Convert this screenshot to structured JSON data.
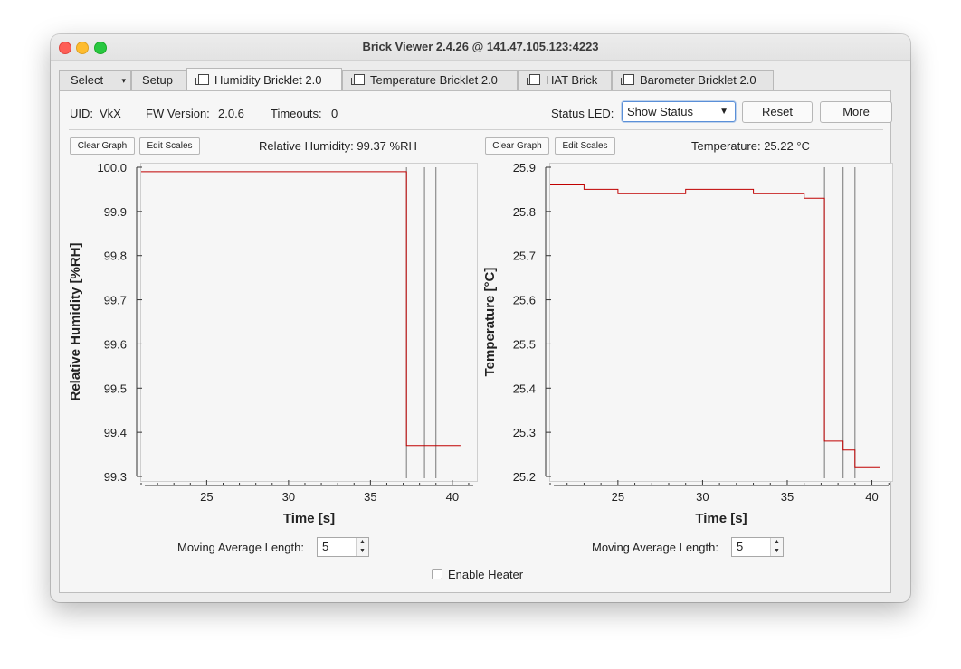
{
  "window": {
    "title": "Brick Viewer 2.4.26 @ 141.47.105.123:4223"
  },
  "tabs": [
    {
      "label": "Select",
      "kind": "dropdown"
    },
    {
      "label": "Setup",
      "kind": "tab"
    },
    {
      "label": "Humidity Bricklet 2.0",
      "kind": "tab",
      "active": true
    },
    {
      "label": "Temperature Bricklet 2.0",
      "kind": "tab"
    },
    {
      "label": "HAT Brick",
      "kind": "tab"
    },
    {
      "label": "Barometer Bricklet 2.0",
      "kind": "tab"
    }
  ],
  "info": {
    "uid_label": "UID:",
    "uid_value": "VkX",
    "fw_label": "FW Version:",
    "fw_value": "2.0.6",
    "timeouts_label": "Timeouts:",
    "timeouts_value": "0",
    "status_led_label": "Status LED:",
    "status_led_value": "Show Status",
    "reset_label": "Reset",
    "more_label": "More"
  },
  "humidity": {
    "clear_label": "Clear Graph",
    "scales_label": "Edit Scales",
    "reading": "Relative Humidity: 99.37 %RH",
    "moving_avg_label": "Moving Average Length:",
    "moving_avg_value": "5"
  },
  "temperature": {
    "clear_label": "Clear Graph",
    "scales_label": "Edit Scales",
    "reading": "Temperature: 25.22 °C",
    "moving_avg_label": "Moving Average Length:",
    "moving_avg_value": "5"
  },
  "heater": {
    "label": "Enable Heater",
    "checked": false
  },
  "colors": {
    "line": "#c00000",
    "marker": "#777777",
    "accent": "#5a8fd8"
  },
  "chart_data": [
    {
      "type": "line",
      "xlabel": "Time [s]",
      "ylabel": "Relative Humidity [%RH]",
      "xlim": [
        21,
        41.5
      ],
      "ylim": [
        99.3,
        100.0
      ],
      "xticks": [
        "25",
        "30",
        "35",
        "40"
      ],
      "yticks": [
        "100.0",
        "99.9",
        "99.8",
        "99.7",
        "99.6",
        "99.5",
        "99.4",
        "99.3"
      ],
      "grid": false,
      "series": [
        {
          "x": [
            21.0,
            37.2,
            37.2,
            40.5
          ],
          "y": [
            99.99,
            99.99,
            99.37,
            99.37
          ]
        }
      ],
      "markers": [
        37.2,
        38.3,
        39.0
      ]
    },
    {
      "type": "line",
      "xlabel": "Time [s]",
      "ylabel": "Temperature [°C]",
      "xlim": [
        21,
        41.2
      ],
      "ylim": [
        25.2,
        25.9
      ],
      "xticks": [
        "25",
        "30",
        "35",
        "40"
      ],
      "yticks": [
        "25.9",
        "25.8",
        "25.7",
        "25.6",
        "25.5",
        "25.4",
        "25.3",
        "25.2"
      ],
      "grid": false,
      "series": [
        {
          "x": [
            21.0,
            23.0,
            23.0,
            25.0,
            25.0,
            29.0,
            29.0,
            33.0,
            33.0,
            36.0,
            36.0,
            37.2,
            37.2,
            38.3,
            38.3,
            39.0,
            39.0,
            40.5
          ],
          "y": [
            25.86,
            25.86,
            25.85,
            25.85,
            25.84,
            25.84,
            25.85,
            25.85,
            25.84,
            25.84,
            25.83,
            25.83,
            25.28,
            25.28,
            25.26,
            25.26,
            25.22,
            25.22
          ]
        }
      ],
      "markers": [
        37.2,
        38.3,
        39.0
      ]
    }
  ]
}
